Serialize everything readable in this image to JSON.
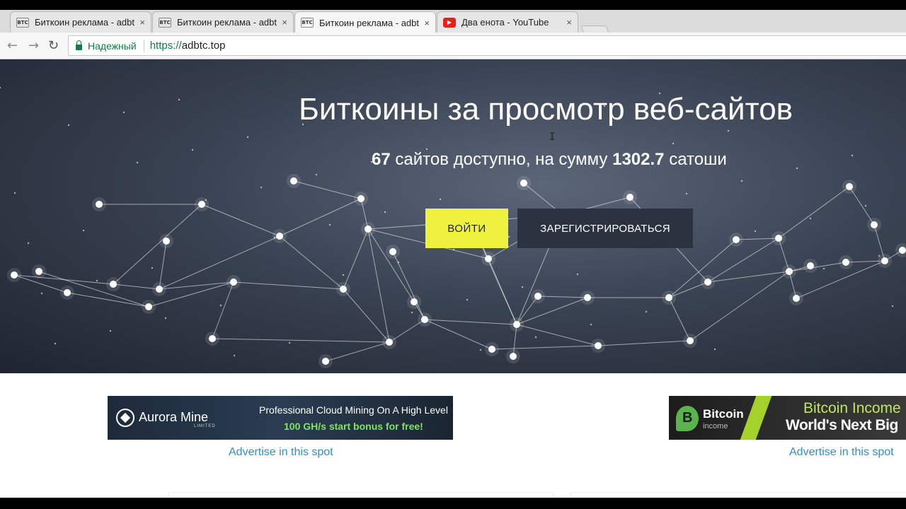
{
  "browser": {
    "tabs": [
      {
        "favicon": "BTC",
        "title": "Биткоин реклама - adbt",
        "active": false
      },
      {
        "favicon": "BTC",
        "title": "Биткоин реклама - adbt",
        "active": false
      },
      {
        "favicon": "BTC",
        "title": "Биткоин реклама - adbt",
        "active": true
      },
      {
        "favicon": "youtube-icon",
        "title": "Два енота - YouTube",
        "active": false
      }
    ],
    "tab_close": "×",
    "nav": {
      "back": "←",
      "forward": "→",
      "reload": "↻"
    },
    "security_label": "Надежный",
    "url_scheme": "https://",
    "url_host": "adbtc.top"
  },
  "hero": {
    "title": "Биткоины за просмотр веб-сайтов",
    "sites_count": "67",
    "sites_text": "сайтов доступно, на сумму",
    "amount": "1302.7",
    "unit": "сатоши",
    "login_label": "ВОЙТИ",
    "register_label": "ЗАРЕГИСТРИРОВАТЬСЯ"
  },
  "ads": {
    "left": {
      "brand": "Aurora Mine",
      "sub": "LIMITED",
      "line1": "Professional Cloud Mining On A High Level",
      "line2": "100 GH/s start bonus for free!"
    },
    "right": {
      "brand1": "Bitcoin",
      "brand2": "income",
      "headline1": "Bitcoin Income",
      "headline2": "World's Next Big"
    },
    "advertise_left": "Advertise in this spot",
    "advertise_right": "Advertise in this spot"
  },
  "colors": {
    "login_button": "#eef23e",
    "register_button": "#2d3240",
    "link": "#2f8fc6",
    "secure": "#0b8043"
  }
}
